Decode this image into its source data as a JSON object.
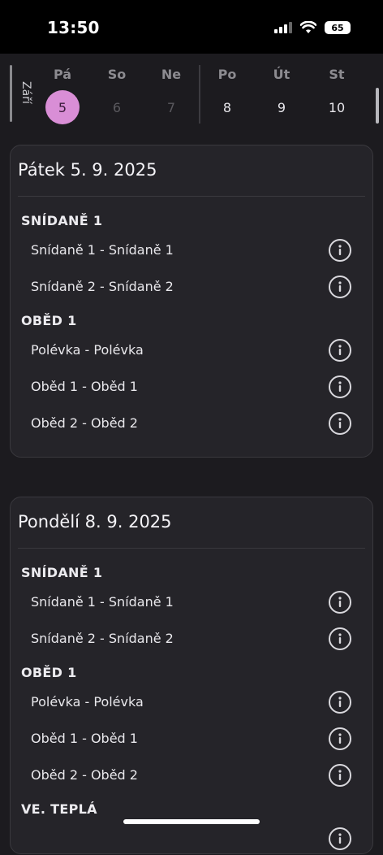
{
  "status": {
    "time": "13:50",
    "battery": "65"
  },
  "calendar": {
    "month": "Září",
    "days": [
      {
        "name": "Pá",
        "num": "5",
        "state": "selected"
      },
      {
        "name": "So",
        "num": "6",
        "state": "past"
      },
      {
        "name": "Ne",
        "num": "7",
        "state": "past"
      },
      {
        "name": "Po",
        "num": "8",
        "state": "normal"
      },
      {
        "name": "Út",
        "num": "9",
        "state": "normal"
      },
      {
        "name": "St",
        "num": "10",
        "state": "normal"
      }
    ]
  },
  "days": [
    {
      "title": "Pátek 5. 9. 2025",
      "sections": [
        {
          "name": "SNÍDANĚ 1",
          "meals": [
            "Snídaně 1 - Snídaně 1",
            "Snídaně 2 - Snídaně 2"
          ]
        },
        {
          "name": "OBĚD 1",
          "meals": [
            "Polévka - Polévka",
            "Oběd 1 - Oběd 1",
            "Oběd 2 - Oběd 2"
          ]
        }
      ]
    },
    {
      "title": "Pondělí 8. 9. 2025",
      "sections": [
        {
          "name": "SNÍDANĚ 1",
          "meals": [
            "Snídaně 1 - Snídaně 1",
            "Snídaně 2 - Snídaně 2"
          ]
        },
        {
          "name": "OBĚD 1",
          "meals": [
            "Polévka - Polévka",
            "Oběd 1 - Oběd 1",
            "Oběd 2 - Oběd 2"
          ]
        },
        {
          "name": "VE. TEPLÁ",
          "meals": []
        }
      ]
    }
  ],
  "colors": {
    "accent": "#d98ed6",
    "background": "#1c1b1f",
    "card": "#252429"
  },
  "icons": {
    "meal_info": "info-circle-icon",
    "wifi": "wifi-icon",
    "signal": "cellular-signal-icon",
    "battery": "battery-icon"
  }
}
